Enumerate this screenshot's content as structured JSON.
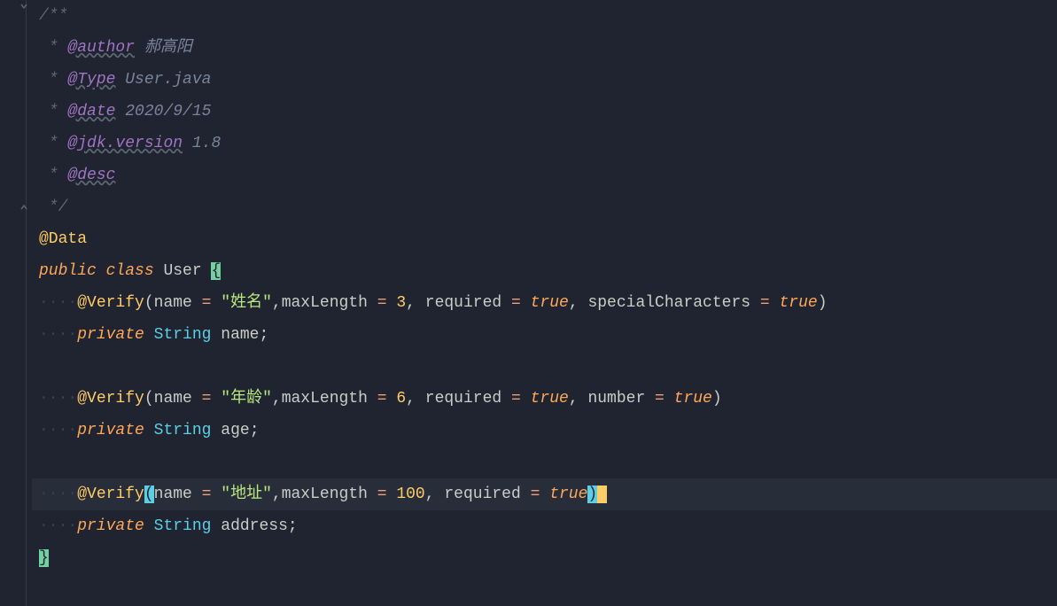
{
  "javadoc": {
    "open": "/**",
    "author_tag": "@author",
    "author_val": "郝高阳",
    "type_tag": "@Type",
    "type_val": "User.java",
    "date_tag": "@date",
    "date_val": "2020/9/15",
    "jdk_tag": "@jdk.version",
    "jdk_val": "1.8",
    "desc_tag": "@desc",
    "close": "*/"
  },
  "annotations": {
    "data": "@Data",
    "verify": "@Verify"
  },
  "keywords": {
    "public": "public",
    "class": "class",
    "private": "private"
  },
  "class_name": "User",
  "types": {
    "string": "String"
  },
  "fields": {
    "f1": {
      "param_name": "name",
      "name_val": "\"姓名\"",
      "maxlen_key": "maxLength",
      "maxlen_val": "3",
      "req_key": "required",
      "req_val": "true",
      "extra_key": "specialCharacters",
      "extra_val": "true",
      "field_name": "name"
    },
    "f2": {
      "param_name": "name",
      "name_val": "\"年龄\"",
      "maxlen_key": "maxLength",
      "maxlen_val": "6",
      "req_key": "required",
      "req_val": "true",
      "extra_key": "number",
      "extra_val": "true",
      "field_name": "age"
    },
    "f3": {
      "param_name": "name",
      "name_val": "\"地址\"",
      "maxlen_key": "maxLength",
      "maxlen_val": "100",
      "req_key": "required",
      "req_val": "true",
      "field_name": "address"
    }
  },
  "punct": {
    "star": " *",
    "lbrace": "{",
    "rbrace": "}",
    "lparen": "(",
    "rparen": ")",
    "eq": " = ",
    "comma": ",",
    "semi": ";",
    "space": " ",
    "dot4": "····"
  }
}
